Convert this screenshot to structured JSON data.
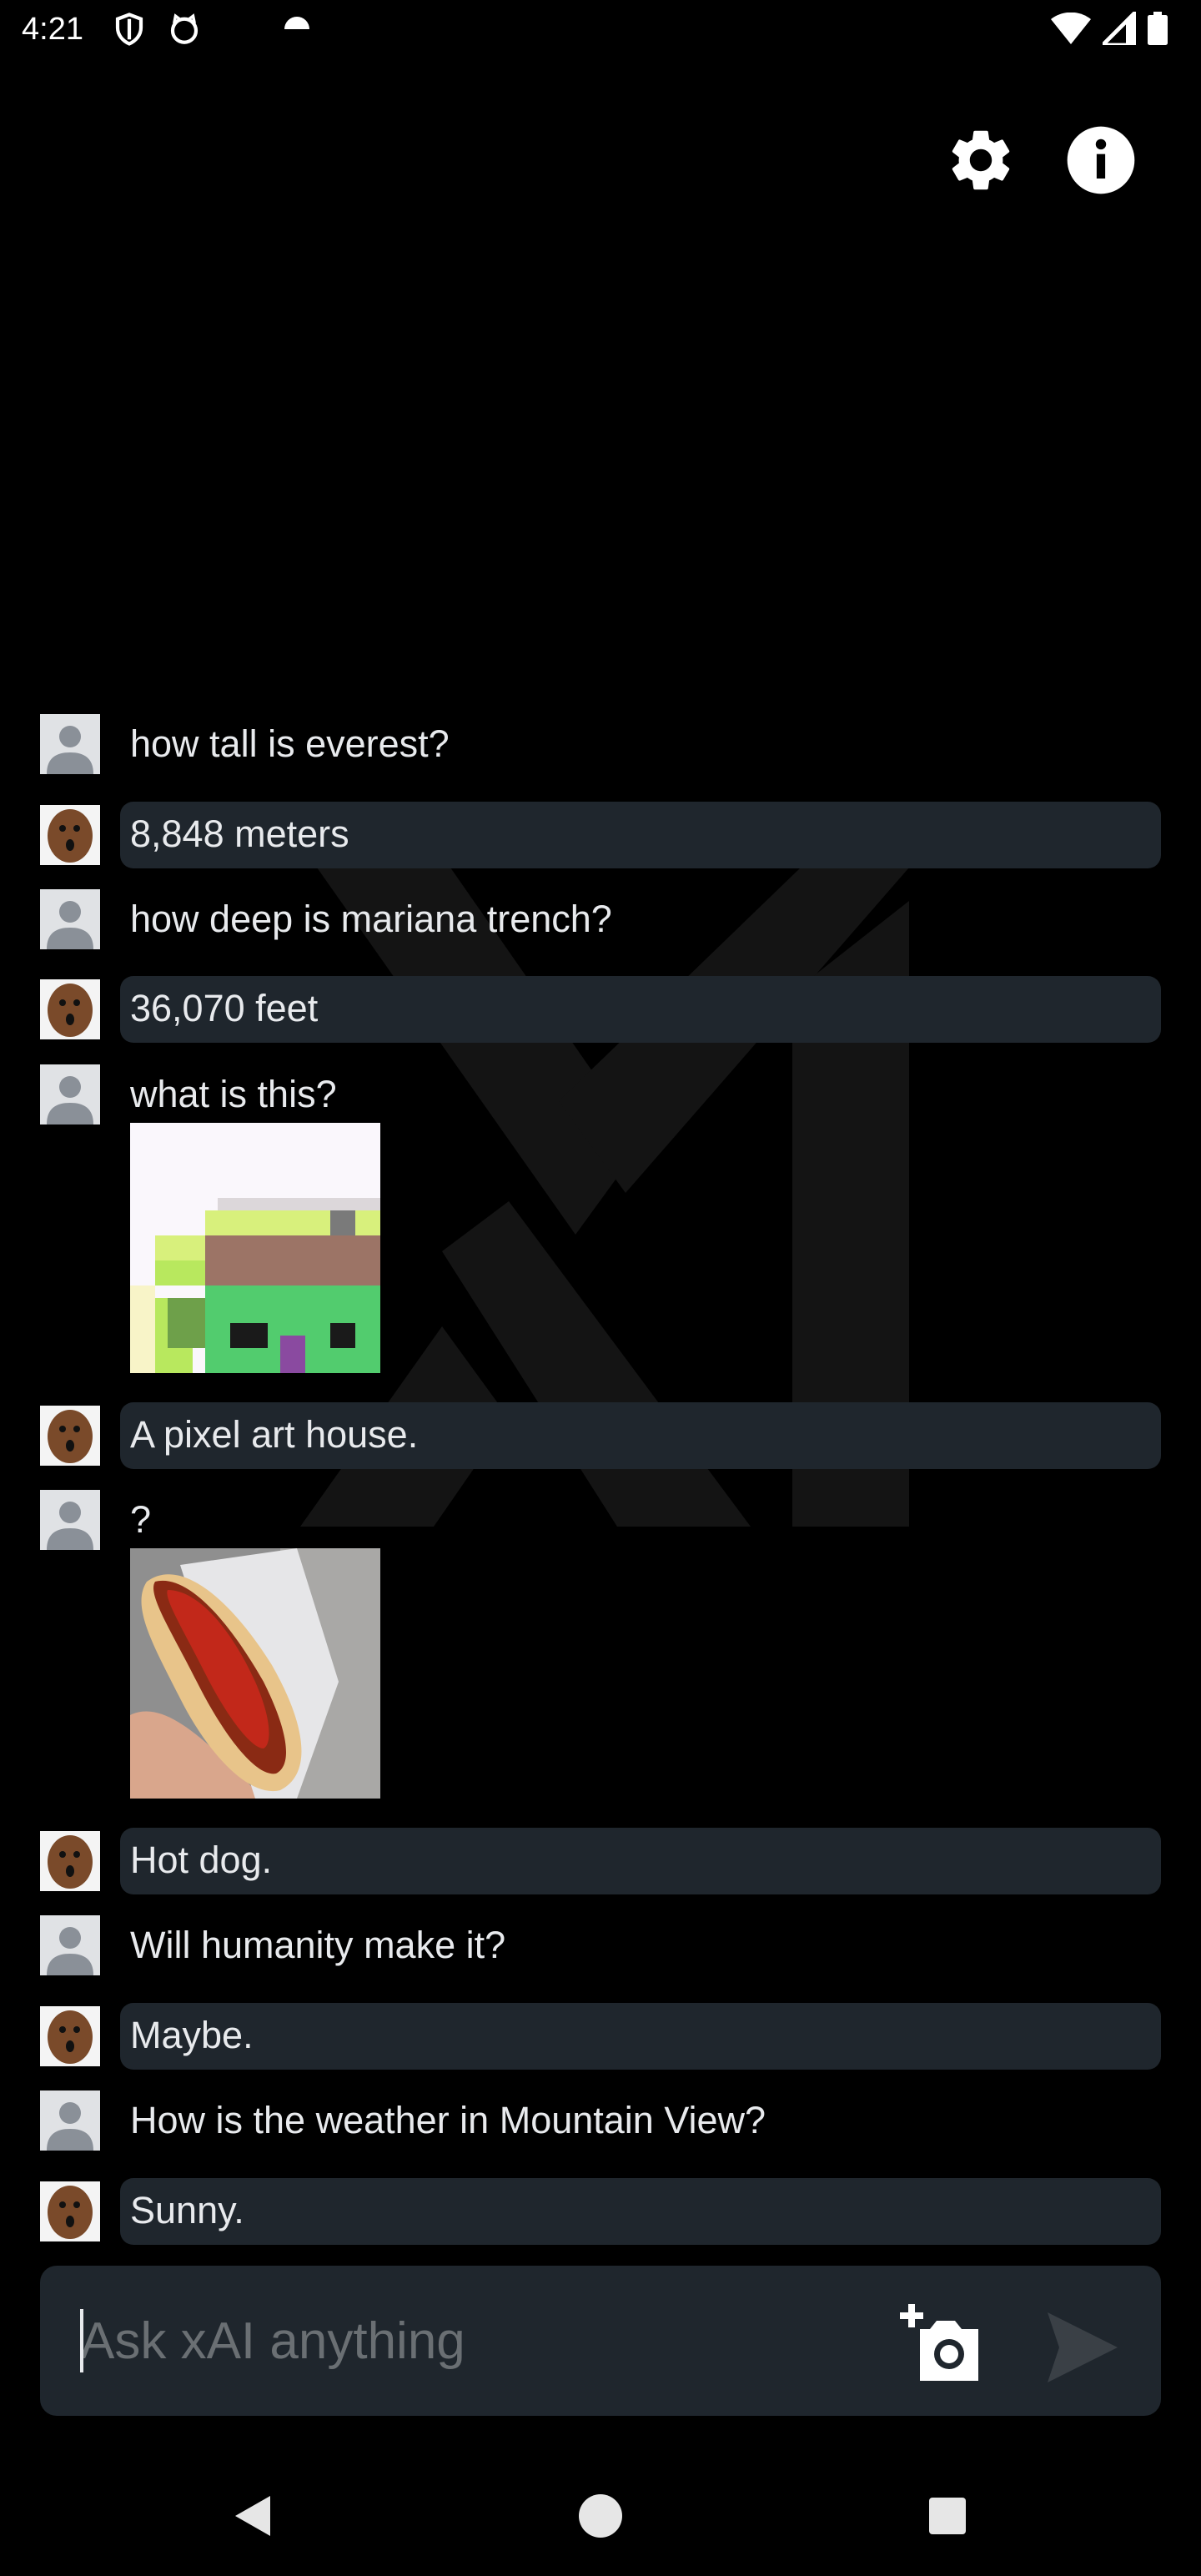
{
  "status_bar": {
    "time": "4:21",
    "icons": [
      "shield-icon",
      "cat-face-icon",
      "notification-dot-icon",
      "wifi-icon",
      "signal-icon",
      "battery-icon"
    ]
  },
  "header": {
    "icons": [
      "settings-gear-icon",
      "info-icon"
    ]
  },
  "messages": [
    {
      "role": "user",
      "text": "how tall is everest?"
    },
    {
      "role": "bot",
      "text": "8,848 meters"
    },
    {
      "role": "user",
      "text": "how deep is mariana trench?"
    },
    {
      "role": "bot",
      "text": "36,070 feet"
    },
    {
      "role": "user",
      "text": "what is this?",
      "image": "pixel-art-house-image"
    },
    {
      "role": "bot",
      "text": "A pixel art house."
    },
    {
      "role": "user",
      "text": "?",
      "image": "hot-dog-photo"
    },
    {
      "role": "bot",
      "text": "Hot dog."
    },
    {
      "role": "user",
      "text": "Will humanity make it?"
    },
    {
      "role": "bot",
      "text": "Maybe."
    },
    {
      "role": "user",
      "text": "How is the weather in Mountain View?"
    },
    {
      "role": "bot",
      "text": "Sunny."
    }
  ],
  "input": {
    "placeholder": "Ask xAI anything",
    "value": "",
    "camera_icon": "add-photo-camera-icon",
    "send_icon": "send-arrow-icon"
  },
  "nav": {
    "icons": [
      "back-triangle-icon",
      "home-circle-icon",
      "recents-square-icon"
    ]
  },
  "colors": {
    "background": "#000000",
    "bubble": "#1f262d",
    "text": "#e8eaed",
    "placeholder": "#6a6f73",
    "send_disabled": "#3a4046"
  }
}
